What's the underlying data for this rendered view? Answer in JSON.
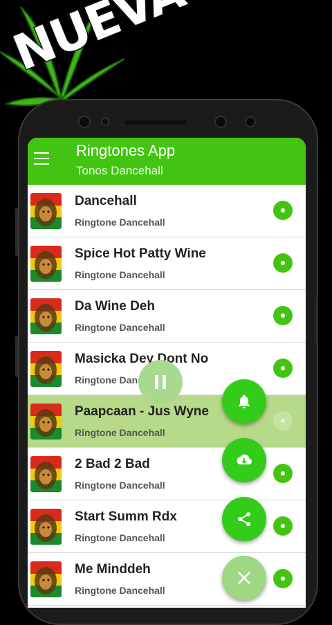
{
  "banner": {
    "text": "NUEVA"
  },
  "appbar": {
    "title": "Ringtones App",
    "subtitle": "Tonos Dancehall"
  },
  "songs": [
    {
      "title": "Dancehall",
      "subtitle": "Ringtone Dancehall"
    },
    {
      "title": "Spice Hot Patty Wine",
      "subtitle": "Ringtone Dancehall"
    },
    {
      "title": "Da Wine Deh",
      "subtitle": "Ringtone Dancehall"
    },
    {
      "title": "Masicka Dey Dont No",
      "subtitle": "Ringtone Dancehall"
    },
    {
      "title": "Paapcaan - Jus Wyne",
      "subtitle": "Ringtone Dancehall"
    },
    {
      "title": "2 Bad 2 Bad",
      "subtitle": "Ringtone Dancehall"
    },
    {
      "title": "Start Summ Rdx",
      "subtitle": "Ringtone Dancehall"
    },
    {
      "title": "Me Minddeh",
      "subtitle": "Ringtone Dancehall"
    }
  ],
  "colors": {
    "accent": "#43c413",
    "active_row": "#b7d98a",
    "fab": "#33cc1a"
  },
  "icons": {
    "menu": "hamburger-icon",
    "alarm": "bell-ring-icon",
    "download": "cloud-download-icon",
    "share": "share-icon",
    "close": "close-icon",
    "pause": "pause-icon"
  }
}
